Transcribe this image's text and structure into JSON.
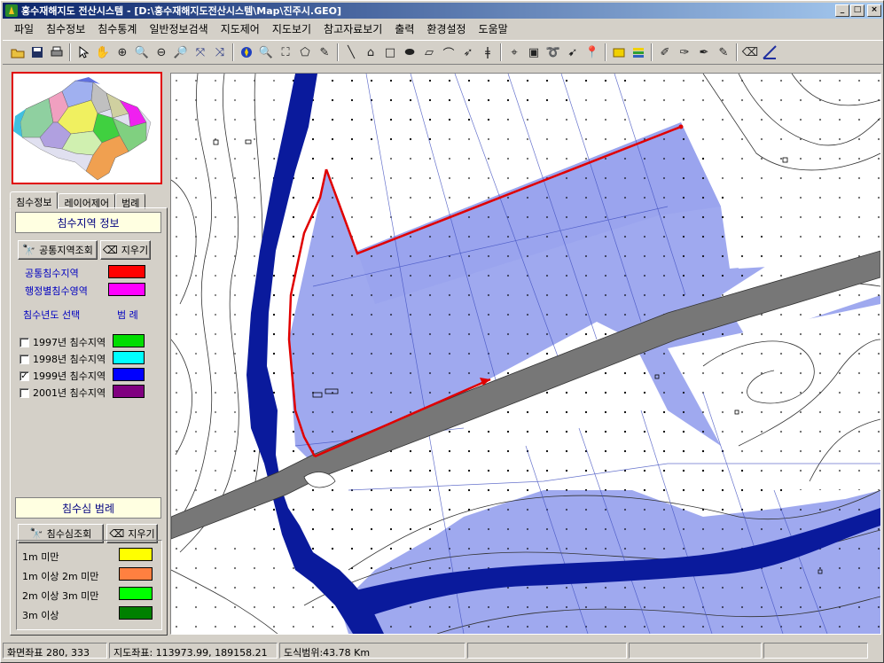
{
  "window": {
    "title": "홍수재해지도 전산시스템 - [D:\\홍수재해지도전산시스템\\Map\\진주시.GEO]",
    "buttons": {
      "minimize": "_",
      "maximize": "□",
      "close": "×"
    }
  },
  "menu": [
    "파일",
    "침수정보",
    "침수통계",
    "일반정보검색",
    "지도제어",
    "지도보기",
    "참고자료보기",
    "출력",
    "환경설정",
    "도움말"
  ],
  "toolbar": {
    "icons": [
      "open-icon",
      "save-icon",
      "print-icon",
      "pointer-icon",
      "pan-hand-icon",
      "zoom-in-region-icon",
      "zoom-in-icon",
      "zoom-out-icon",
      "zoom-search-icon",
      "full-extent-icon",
      "zoom-fit-icon",
      "compass-icon",
      "magnifier-icon",
      "polygon-select-icon",
      "polygon-icon",
      "pen-icon",
      "line-icon",
      "polyline-icon",
      "rectangle-icon",
      "ellipse-icon",
      "region-icon",
      "arc-icon",
      "arrow-icon",
      "text-icon",
      "select-point-icon",
      "select-rect-icon",
      "select-lasso-icon",
      "select-cursor-icon",
      "pin-icon",
      "layer-yellow-icon",
      "layer-stack-icon",
      "edit-layer-icon",
      "edit-layer2-icon",
      "edit-layer3-icon",
      "edit-layer4-icon",
      "eraser-icon",
      "measure-icon"
    ]
  },
  "tabs": [
    "침수정보",
    "레이어제어",
    "범례"
  ],
  "flood_info": {
    "header": "침수지역 정보",
    "query_button": "공통지역조회",
    "clear_button": "지우기",
    "legend": [
      {
        "label": "공통침수지역",
        "color": "#ff0000"
      },
      {
        "label": "행정별침수영역",
        "color": "#ff00ff"
      }
    ],
    "year_select_label": "침수년도 선택",
    "legend_label": "범 례",
    "years": [
      {
        "label": "1997년 침수지역",
        "checked": false,
        "color": "#00dd00"
      },
      {
        "label": "1998년 침수지역",
        "checked": false,
        "color": "#00ffff"
      },
      {
        "label": "1999년 침수지역",
        "checked": true,
        "color": "#0000ff"
      },
      {
        "label": "2001년 침수지역",
        "checked": false,
        "color": "#800080"
      }
    ]
  },
  "depth": {
    "header": "침수심 범례",
    "query_button": "침수심조회",
    "clear_button": "지우기",
    "levels": [
      {
        "label": "1m 미만",
        "color": "#ffff00"
      },
      {
        "label": "1m 이상 2m 미만",
        "color": "#ff8040"
      },
      {
        "label": "2m 이상 3m 미만",
        "color": "#00ff00"
      },
      {
        "label": "3m 이상",
        "color": "#008000"
      }
    ]
  },
  "status": {
    "screen_coord": "화면좌표 280, 333",
    "map_coord": "지도좌표: 113973.99,  189158.21",
    "map_scale": "도식범위:43.78 Km"
  }
}
